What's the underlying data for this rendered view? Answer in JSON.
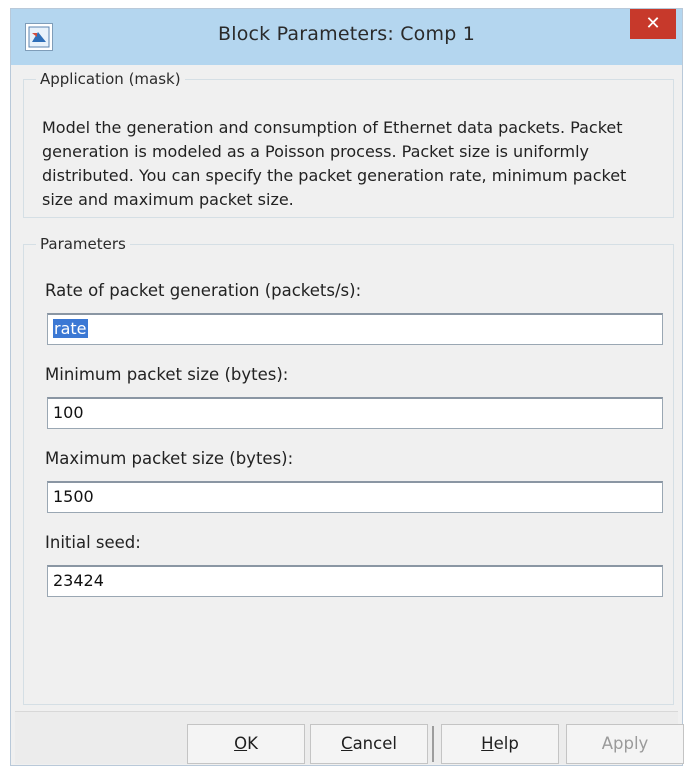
{
  "window": {
    "title": "Block Parameters: Comp 1",
    "close_glyph": "✕"
  },
  "application_group": {
    "legend": "Application (mask)",
    "description": "Model the generation and consumption of Ethernet data packets. Packet generation is modeled as a Poisson process. Packet size is uniformly distributed. You can specify the packet generation rate, minimum packet size and maximum packet size."
  },
  "parameters_group": {
    "legend": "Parameters",
    "fields": [
      {
        "label": "Rate of packet generation (packets/s):",
        "value": "rate"
      },
      {
        "label": "Minimum packet size (bytes):",
        "value": "100"
      },
      {
        "label": "Maximum packet size (bytes):",
        "value": "1500"
      },
      {
        "label": "Initial seed:",
        "value": "23424"
      }
    ]
  },
  "buttons": {
    "ok": {
      "mnemonic": "O",
      "rest": "K"
    },
    "cancel": {
      "mnemonic": "C",
      "rest": "ancel"
    },
    "help": {
      "mnemonic": "H",
      "rest": "elp"
    },
    "apply": {
      "label": "Apply",
      "disabled": true
    }
  },
  "colors": {
    "titlebar": "#b4d6ef",
    "close_button": "#c7392b",
    "selection": "#3b78d4"
  },
  "icons": {
    "app": "simulink-block-icon",
    "close": "close-icon"
  }
}
